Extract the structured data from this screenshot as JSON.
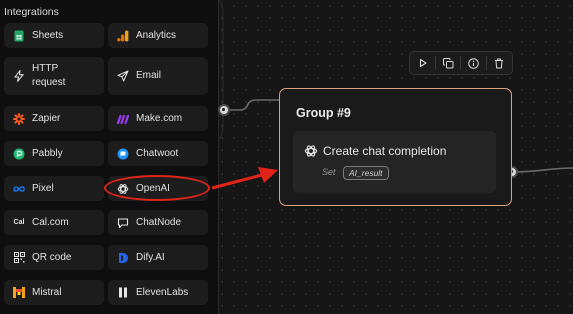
{
  "sidebar": {
    "title": "Integrations",
    "items": [
      {
        "label": "Sheets",
        "icon": "google-sheets-icon",
        "color": "#22a565"
      },
      {
        "label": "Analytics",
        "icon": "google-analytics-icon",
        "color": "#f2a024"
      },
      {
        "label": "HTTP request",
        "icon": "lightning-icon",
        "color": "#e6e6e6"
      },
      {
        "label": "Email",
        "icon": "send-icon",
        "color": "#e6e6e6"
      },
      {
        "label": "Zapier",
        "icon": "zapier-icon",
        "color": "#ff5a1f"
      },
      {
        "label": "Make.com",
        "icon": "make-icon",
        "color": "#9b3cf0"
      },
      {
        "label": "Pabbly",
        "icon": "pabbly-icon",
        "color": "#20b873"
      },
      {
        "label": "Chatwoot",
        "icon": "chatwoot-icon",
        "color": "#1f93ff"
      },
      {
        "label": "Pixel",
        "icon": "meta-icon",
        "color": "#1877f2"
      },
      {
        "label": "OpenAI",
        "icon": "openai-icon",
        "color": "#e6e6e6"
      },
      {
        "label": "Cal.com",
        "icon": "cal-icon",
        "color": "#e6e6e6"
      },
      {
        "label": "ChatNode",
        "icon": "chatnode-icon",
        "color": "#e6e6e6"
      },
      {
        "label": "QR code",
        "icon": "qr-code-icon",
        "color": "#e6e6e6"
      },
      {
        "label": "Dify.AI",
        "icon": "dify-icon",
        "color": "#2563eb"
      },
      {
        "label": "Mistral",
        "icon": "mistral-icon",
        "color": "#f7a21a"
      },
      {
        "label": "ElevenLabs",
        "icon": "elevenlabs-icon",
        "color": "#e6e6e6"
      }
    ]
  },
  "annotation": {
    "highlight_color": "#e0241a"
  },
  "group": {
    "title": "Group #9",
    "accent": "#dca07d",
    "block": {
      "icon": "openai-icon",
      "title": "Create chat completion",
      "set_label": "Set",
      "variable": "AI_result"
    },
    "toolbar": [
      "play-icon",
      "duplicate-icon",
      "info-icon",
      "trash-icon"
    ]
  }
}
